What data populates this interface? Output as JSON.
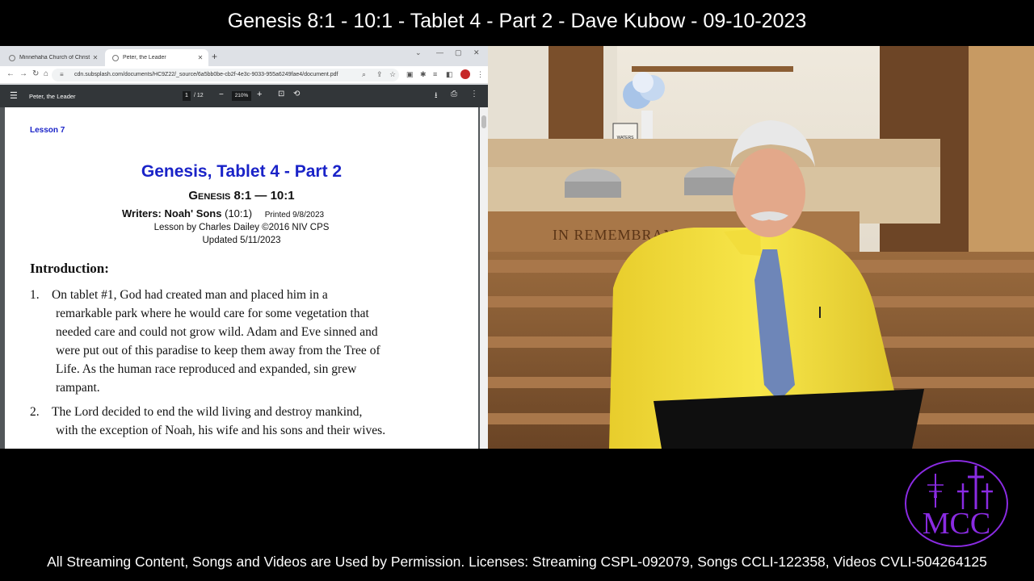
{
  "stream": {
    "title": "Genesis 8:1 - 10:1 - Tablet 4 - Part 2 - Dave Kubow - 09-10-2023",
    "footer": "All Streaming Content, Songs and Videos are Used by Permission. Licenses: Streaming CSPL-092079, Songs CCLI-122358, Videos CVLI-504264125",
    "logo_text": "MCC",
    "logo_color": "#8a2be2"
  },
  "browser": {
    "tabs": [
      {
        "label": "Minnehaha Church of Christ - Hi",
        "active": false
      },
      {
        "label": "Peter, the Leader",
        "active": true
      }
    ],
    "url": "cdn.subsplash.com/documents/HC9Z22/_source/6a5bb0be-cb2f-4e3c-9033-955a6249fae4/document.pdf"
  },
  "pdf_toolbar": {
    "title": "Peter, the Leader",
    "page_current": "1",
    "page_total": "/ 12",
    "zoom": "210%"
  },
  "document": {
    "lesson": "Lesson 7",
    "title": "Genesis, Tablet 4 - Part 2",
    "subtitle": "Genesis 8:1 — 10:1",
    "writers_label": "Writers: Noah' Sons",
    "writers_ref": "(10:1)",
    "printed": "Printed 9/8/2023",
    "credit": "Lesson by Charles Dailey ©2016 NIV   CPS",
    "updated": "Updated 5/11/2023",
    "intro_heading": "Introduction:",
    "paragraphs": [
      {
        "num": "1.",
        "lines": [
          "On tablet #1, God had created man and placed him in a",
          "remarkable park where he would care for some vegetation that",
          "needed care and could not grow wild. Adam and Eve sinned and",
          "were put out of this paradise to keep them away from the Tree of",
          "Life. As the human race reproduced and expanded, sin grew",
          "rampant."
        ]
      },
      {
        "num": "2.",
        "lines": [
          "The Lord decided to end the wild living and destroy mankind,",
          "with the exception of Noah, his wife and his sons and their wives."
        ]
      }
    ]
  },
  "camera": {
    "banner_text": "IN REMEMBRANCE",
    "sign_text": "WATERS"
  }
}
